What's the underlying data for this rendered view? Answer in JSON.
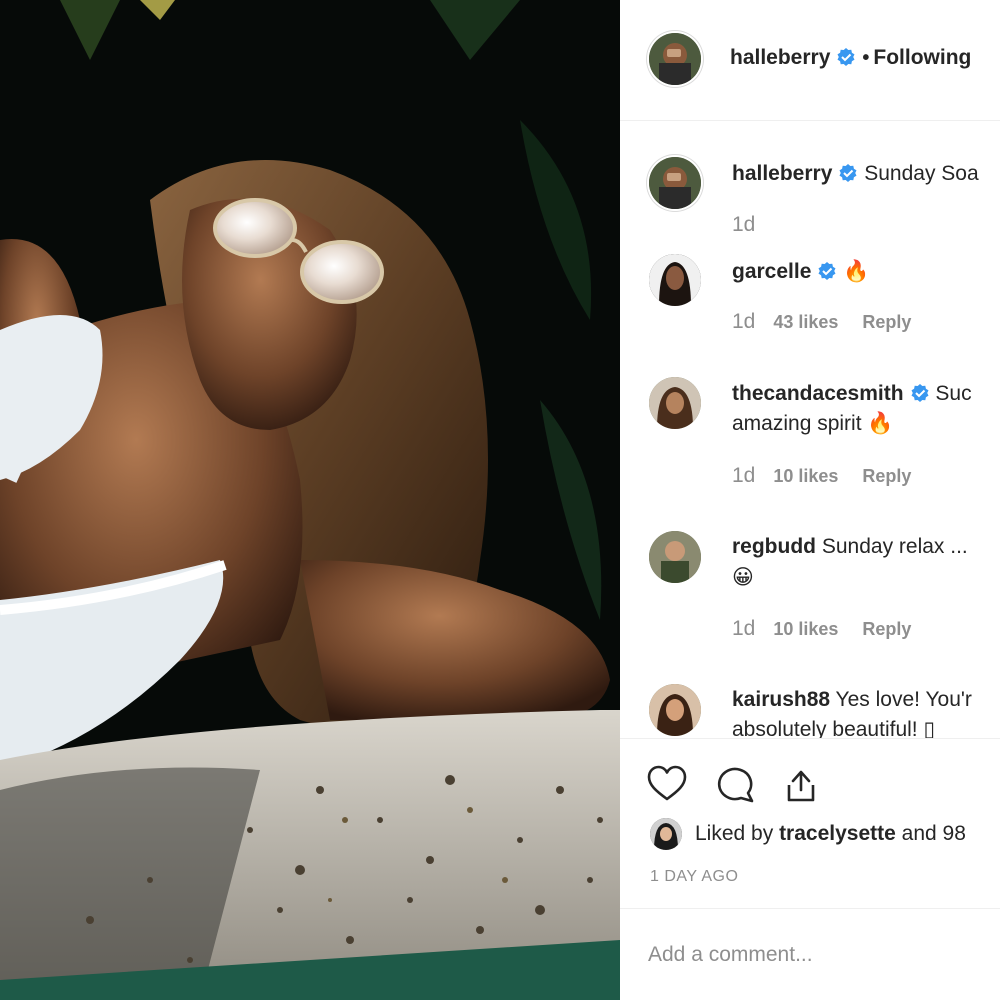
{
  "header": {
    "username": "halleberry",
    "separator": "•",
    "follow_label": "Following"
  },
  "comments": [
    {
      "user": "halleberry",
      "text": "Sunday Soa",
      "time": "1d",
      "likes": "",
      "reply": ""
    },
    {
      "user": "garcelle",
      "text": "🔥",
      "time": "1d",
      "likes": "43 likes",
      "reply": "Reply"
    },
    {
      "user": "thecandacesmith",
      "text": "Suc",
      "text2": "amazing spirit 🔥",
      "time": "1d",
      "likes": "10 likes",
      "reply": "Reply"
    },
    {
      "user": "regbudd",
      "text": "Sunday relax ...",
      "text2": "😀",
      "time": "1d",
      "likes": "10 likes",
      "reply": "Reply"
    },
    {
      "user": "kairush88",
      "text": "Yes love! You'r",
      "text2": "absolutely beautiful! ▯"
    }
  ],
  "actions": {
    "like_icon": "heart-icon",
    "comment_icon": "comment-icon",
    "share_icon": "share-icon"
  },
  "likes": {
    "prefix": "Liked by ",
    "user": "tracelysette",
    "suffix": " and 98"
  },
  "timestamp": "1 DAY AGO",
  "add_comment": {
    "placeholder": "Add a comment..."
  },
  "colors": {
    "verified": "#3897f0",
    "muted": "#8e8e8e",
    "text": "#262626"
  }
}
